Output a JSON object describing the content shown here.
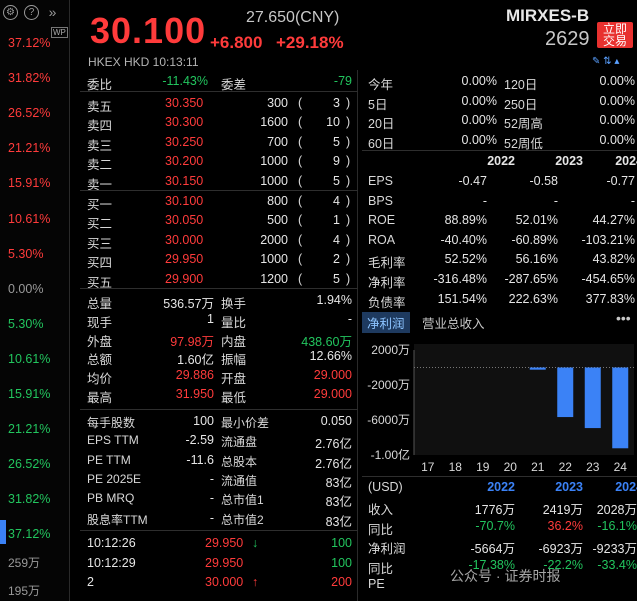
{
  "left": {
    "icons": [
      "settings-icon",
      "help-icon",
      "expand-icon"
    ],
    "scale": [
      {
        "label": "37.12%",
        "color": "red"
      },
      {
        "label": "31.82%",
        "color": "red"
      },
      {
        "label": "26.52%",
        "color": "red"
      },
      {
        "label": "21.21%",
        "color": "red"
      },
      {
        "label": "15.91%",
        "color": "red"
      },
      {
        "label": "10.61%",
        "color": "red"
      },
      {
        "label": "5.30%",
        "color": "red"
      },
      {
        "label": "0.00%",
        "color": "gray"
      },
      {
        "label": "5.30%",
        "color": "green"
      },
      {
        "label": "10.61%",
        "color": "green"
      },
      {
        "label": "15.91%",
        "color": "green"
      },
      {
        "label": "21.21%",
        "color": "green"
      },
      {
        "label": "26.52%",
        "color": "green"
      },
      {
        "label": "31.82%",
        "color": "green"
      },
      {
        "label": "37.12%",
        "color": "green"
      }
    ],
    "extra": [
      "259万",
      "195万"
    ],
    "wp_badge": "WP"
  },
  "header": {
    "price": "30.100",
    "prev_close": "27.650(CNY)",
    "change": "+6.800",
    "change_pct": "+29.18%",
    "name": "MIRXES-B",
    "code": "2629",
    "trade_btn": "立即\n交易",
    "market_line": "HKEX  HKD  10:13:11"
  },
  "book": {
    "ratio": {
      "label1": "委比",
      "value1": "-11.43%",
      "label2": "委差",
      "value2": "-79"
    },
    "asks": [
      {
        "label": "卖五",
        "price": "30.350",
        "qty": "300",
        "count": "3"
      },
      {
        "label": "卖四",
        "price": "30.300",
        "qty": "1600",
        "count": "10"
      },
      {
        "label": "卖三",
        "price": "30.250",
        "qty": "700",
        "count": "5"
      },
      {
        "label": "卖二",
        "price": "30.200",
        "qty": "1000",
        "count": "9"
      },
      {
        "label": "卖一",
        "price": "30.150",
        "qty": "1000",
        "count": "5"
      }
    ],
    "bids": [
      {
        "label": "买一",
        "price": "30.100",
        "qty": "800",
        "count": "4",
        "pcolor": "red"
      },
      {
        "label": "买二",
        "price": "30.050",
        "qty": "500",
        "count": "1",
        "pcolor": "red"
      },
      {
        "label": "买三",
        "price": "30.000",
        "qty": "2000",
        "count": "4",
        "pcolor": "red"
      },
      {
        "label": "买四",
        "price": "29.950",
        "qty": "1000",
        "count": "2",
        "pcolor": "red"
      },
      {
        "label": "买五",
        "price": "29.900",
        "qty": "1200",
        "count": "5",
        "pcolor": "red"
      }
    ],
    "stats": [
      {
        "l1": "总量",
        "v1": "536.57万",
        "c1": "white",
        "l2": "换手",
        "v2": "1.94%",
        "c2": "white"
      },
      {
        "l1": "现手",
        "v1": "1",
        "c1": "white",
        "l2": "量比",
        "v2": "-",
        "c2": "white"
      },
      {
        "l1": "外盘",
        "v1": "97.98万",
        "c1": "red",
        "l2": "内盘",
        "v2": "438.60万",
        "c2": "green"
      },
      {
        "l1": "总额",
        "v1": "1.60亿",
        "c1": "white",
        "l2": "振幅",
        "v2": "12.66%",
        "c2": "white"
      },
      {
        "l1": "均价",
        "v1": "29.886",
        "c1": "red",
        "l2": "开盘",
        "v2": "29.000",
        "c2": "red"
      },
      {
        "l1": "最高",
        "v1": "31.950",
        "c1": "red",
        "l2": "最低",
        "v2": "29.000",
        "c2": "red"
      }
    ],
    "info": [
      {
        "l1": "每手股数",
        "v1": "100",
        "l2": "最小价差",
        "v2": "0.050"
      },
      {
        "l1": "EPS TTM",
        "v1": "-2.59",
        "l2": "流通盘",
        "v2": "2.76亿"
      },
      {
        "l1": "PE TTM",
        "v1": "-11.6",
        "l2": "总股本",
        "v2": "2.76亿"
      },
      {
        "l1": "PE 2025E",
        "v1": "-",
        "l2": "流通值",
        "v2": "83亿"
      },
      {
        "l1": "PB MRQ",
        "v1": "-",
        "l2": "总市值1",
        "v2": "83亿"
      },
      {
        "l1": "股息率TTM",
        "v1": "-",
        "l2": "总市值2",
        "v2": "83亿"
      }
    ],
    "ticks": [
      {
        "time": "10:12:26",
        "price": "29.950",
        "dir": "↓",
        "dcolor": "green",
        "vol": "100",
        "vcolor": "green"
      },
      {
        "time": "10:12:29",
        "price": "29.950",
        "dir": "",
        "dcolor": "green",
        "vol": "100",
        "vcolor": "green"
      },
      {
        "time": "2",
        "price": "30.000",
        "dir": "↑",
        "dcolor": "red",
        "vol": "200",
        "vcolor": "red"
      }
    ]
  },
  "quote": {
    "periods": [
      {
        "l1": "今年",
        "v1": "0.00%",
        "l2": "120日",
        "v2": "0.00%"
      },
      {
        "l1": "5日",
        "v1": "0.00%",
        "l2": "250日",
        "v2": "0.00%"
      },
      {
        "l1": "20日",
        "v1": "0.00%",
        "l2": "52周高",
        "v2": "0.00%"
      },
      {
        "l1": "60日",
        "v1": "0.00%",
        "l2": "52周低",
        "v2": "0.00%"
      }
    ],
    "years": [
      "2022",
      "2023",
      "2024"
    ],
    "metrics": [
      {
        "label": "EPS",
        "v": [
          "-0.47",
          "-0.58",
          "-0.77"
        ]
      },
      {
        "label": "BPS",
        "v": [
          "-",
          "-",
          "-"
        ]
      },
      {
        "label": "ROE",
        "v": [
          "88.89%",
          "52.01%",
          "44.27%"
        ]
      },
      {
        "label": "ROA",
        "v": [
          "-40.40%",
          "-60.89%",
          "-103.21%"
        ]
      },
      {
        "label": "毛利率",
        "v": [
          "52.52%",
          "56.16%",
          "43.82%"
        ]
      },
      {
        "label": "净利率",
        "v": [
          "-316.48%",
          "-287.65%",
          "-454.65%"
        ]
      },
      {
        "label": "负债率",
        "v": [
          "151.54%",
          "222.63%",
          "377.83%"
        ]
      }
    ]
  },
  "chart": {
    "tab_net": "净利润",
    "tab_rev": "营业总收入",
    "more": "•••",
    "y_labels": [
      "2000万",
      "-2000万",
      "-6000万",
      "-1.00亿"
    ],
    "x_labels": [
      "17",
      "18",
      "19",
      "20",
      "21",
      "22",
      "23",
      "24"
    ]
  },
  "chart_data": {
    "type": "bar",
    "categories": [
      "17",
      "18",
      "19",
      "20",
      "21",
      "22",
      "23",
      "24"
    ],
    "values": [
      0,
      0,
      0,
      0,
      -250,
      -5664,
      -6923,
      -9233
    ],
    "unit": "万",
    "ylim": [
      -10000,
      2000
    ],
    "ytick_values": [
      2000,
      -2000,
      -6000,
      -10000
    ],
    "bar_color": "#3b82f6"
  },
  "fin": {
    "currency": "(USD)",
    "years": [
      "2022",
      "2023",
      "2024"
    ],
    "rows": [
      {
        "label": "收入",
        "v": [
          "1776万",
          "2419万",
          "2028万"
        ],
        "c": [
          "white",
          "white",
          "white"
        ]
      },
      {
        "label": "同比",
        "v": [
          "-70.7%",
          "36.2%",
          "-16.1%"
        ],
        "c": [
          "green",
          "red",
          "green"
        ]
      },
      {
        "label": "净利润",
        "v": [
          "-5664万",
          "-6923万",
          "-9233万"
        ],
        "c": [
          "white",
          "white",
          "white"
        ]
      },
      {
        "label": "同比",
        "v": [
          "-17.38%",
          "-22.2%",
          "-33.4%"
        ],
        "c": [
          "green",
          "green",
          "green"
        ]
      },
      {
        "label": "PE",
        "v": [
          "",
          "",
          ""
        ],
        "c": [
          "white",
          "white",
          "white"
        ]
      }
    ]
  },
  "watermark": "公众号 · 证券时报"
}
